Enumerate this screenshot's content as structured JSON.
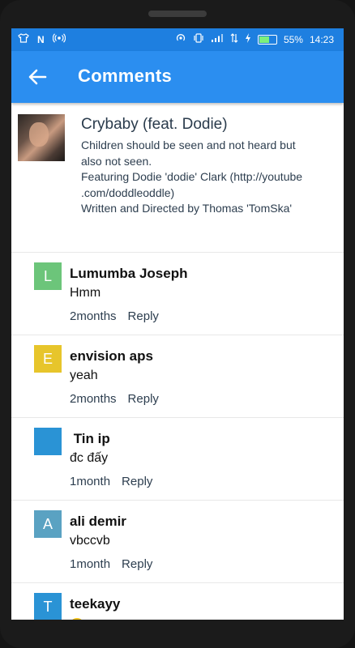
{
  "status_bar": {
    "left_icons": [
      "shirt-icon",
      "n-icon",
      "hotspot-icon"
    ],
    "right_icons": [
      "nfc-icon",
      "vibrate-icon",
      "signal-icon",
      "data-icon",
      "charging-icon"
    ],
    "battery_percent": "55%",
    "time": "14:23",
    "battery_level": 0.55
  },
  "app_bar": {
    "title": "Comments",
    "back_icon": "arrow-left-icon",
    "color": "#2b8ef0"
  },
  "video": {
    "title": "Crybaby (feat. Dodie)",
    "description_lines": [
      "Children should be seen and not heard but",
      "also not seen.",
      "Featuring Dodie 'dodie' Clark (http://youtube",
      ".com/doddleoddle)",
      "Written and Directed by Thomas 'TomSka'"
    ]
  },
  "comments": [
    {
      "avatar_letter": "L",
      "avatar_color": "#6cc57a",
      "author": "Lumumba Joseph",
      "text": "Hmm",
      "time": "2months",
      "reply": "Reply"
    },
    {
      "avatar_letter": "E",
      "avatar_color": "#e7c52b",
      "author": "envision aps",
      "text": "yeah",
      "time": "2months",
      "reply": "Reply"
    },
    {
      "avatar_letter": "",
      "avatar_color": "#2a93d5",
      "author": " Tin ip",
      "text": "đc đấy",
      "time": "1month",
      "reply": "Reply"
    },
    {
      "avatar_letter": "A",
      "avatar_color": "#5aa2c2",
      "author": "ali demir",
      "text": "vbccvb",
      "time": "1month",
      "reply": "Reply"
    },
    {
      "avatar_letter": "T",
      "avatar_color": "#2a93d5",
      "author": "teekayy",
      "text": "",
      "time": "",
      "reply": ""
    }
  ]
}
